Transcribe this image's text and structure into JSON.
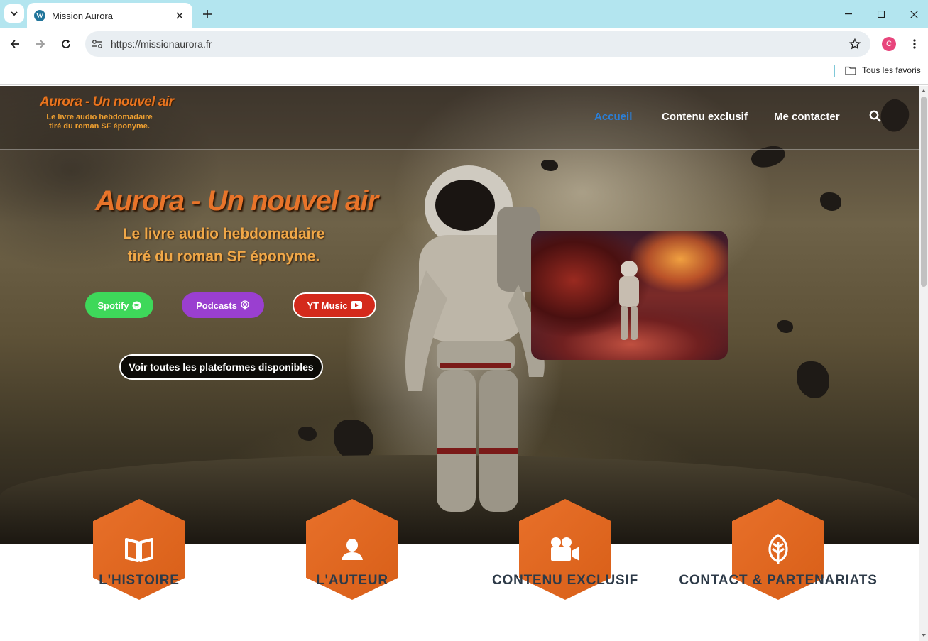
{
  "browser": {
    "tab_title": "Mission Aurora",
    "url": "https://missionaurora.fr",
    "profile_initial": "C",
    "bookmarks_all": "Tous les favoris"
  },
  "site": {
    "logo_title": "Aurora - Un nouvel air",
    "logo_sub_line1": "Le livre audio hebdomadaire",
    "logo_sub_line2": "tiré du roman SF éponyme.",
    "nav": {
      "home": "Accueil",
      "exclusive": "Contenu exclusif",
      "contact": "Me contacter"
    },
    "hero": {
      "title": "Aurora - Un nouvel air",
      "sub_line1": "Le livre audio hebdomadaire",
      "sub_line2": "tiré du roman SF éponyme.",
      "spotify": "Spotify",
      "podcasts": "Podcasts",
      "yt": "YT Music",
      "all_platforms": "Voir toutes les plateformes disponibles"
    },
    "features": [
      {
        "label": "L'HISTOIRE",
        "icon": "book-icon"
      },
      {
        "label": "L'AUTEUR",
        "icon": "person-icon"
      },
      {
        "label": "CONTENU EXCLUSIF",
        "icon": "video-camera-icon"
      },
      {
        "label": "CONTACT & PARTENARIATS",
        "icon": "leaf-icon"
      }
    ]
  },
  "colors": {
    "accent_orange": "#e8702a",
    "nav_active": "#2b7fd8",
    "spotify": "#3ed85a",
    "podcasts": "#9a3fd0",
    "yt": "#d42a1c",
    "feature_text": "#2d3a48"
  }
}
